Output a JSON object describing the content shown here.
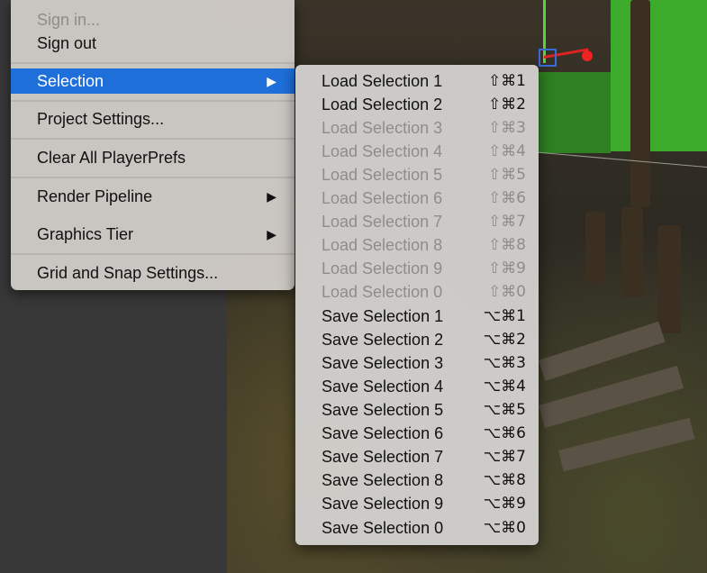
{
  "main_menu": {
    "items": [
      {
        "label": "Sign in...",
        "disabled": true,
        "has_submenu": false
      },
      {
        "label": "Sign out",
        "disabled": false,
        "has_submenu": false
      },
      {
        "label": "Selection",
        "disabled": false,
        "has_submenu": true,
        "highlighted": true
      },
      {
        "label": "Project Settings...",
        "disabled": false,
        "has_submenu": false
      },
      {
        "label": "Clear All PlayerPrefs",
        "disabled": false,
        "has_submenu": false
      },
      {
        "label": "Render Pipeline",
        "disabled": false,
        "has_submenu": true
      },
      {
        "label": "Graphics Tier",
        "disabled": false,
        "has_submenu": true
      },
      {
        "label": "Grid and Snap Settings...",
        "disabled": false,
        "has_submenu": false
      }
    ],
    "submenu_arrow": "▶"
  },
  "selection_submenu": {
    "items": [
      {
        "label": "Load Selection 1",
        "shortcut": "⇧⌘1",
        "disabled": false
      },
      {
        "label": "Load Selection 2",
        "shortcut": "⇧⌘2",
        "disabled": false
      },
      {
        "label": "Load Selection 3",
        "shortcut": "⇧⌘3",
        "disabled": true
      },
      {
        "label": "Load Selection 4",
        "shortcut": "⇧⌘4",
        "disabled": true
      },
      {
        "label": "Load Selection 5",
        "shortcut": "⇧⌘5",
        "disabled": true
      },
      {
        "label": "Load Selection 6",
        "shortcut": "⇧⌘6",
        "disabled": true
      },
      {
        "label": "Load Selection 7",
        "shortcut": "⇧⌘7",
        "disabled": true
      },
      {
        "label": "Load Selection 8",
        "shortcut": "⇧⌘8",
        "disabled": true
      },
      {
        "label": "Load Selection 9",
        "shortcut": "⇧⌘9",
        "disabled": true
      },
      {
        "label": "Load Selection 0",
        "shortcut": "⇧⌘0",
        "disabled": true
      },
      {
        "label": "Save Selection 1",
        "shortcut": "⌥⌘1",
        "disabled": false
      },
      {
        "label": "Save Selection 2",
        "shortcut": "⌥⌘2",
        "disabled": false
      },
      {
        "label": "Save Selection 3",
        "shortcut": "⌥⌘3",
        "disabled": false
      },
      {
        "label": "Save Selection 4",
        "shortcut": "⌥⌘4",
        "disabled": false
      },
      {
        "label": "Save Selection 5",
        "shortcut": "⌥⌘5",
        "disabled": false
      },
      {
        "label": "Save Selection 6",
        "shortcut": "⌥⌘6",
        "disabled": false
      },
      {
        "label": "Save Selection 7",
        "shortcut": "⌥⌘7",
        "disabled": false
      },
      {
        "label": "Save Selection 8",
        "shortcut": "⌥⌘8",
        "disabled": false
      },
      {
        "label": "Save Selection 9",
        "shortcut": "⌥⌘9",
        "disabled": false
      },
      {
        "label": "Save Selection 0",
        "shortcut": "⌥⌘0",
        "disabled": false
      }
    ]
  },
  "colors": {
    "highlight": "#1e6fd9",
    "disabled_text": "#8f8c89",
    "scene_green": "#3cab2b"
  }
}
